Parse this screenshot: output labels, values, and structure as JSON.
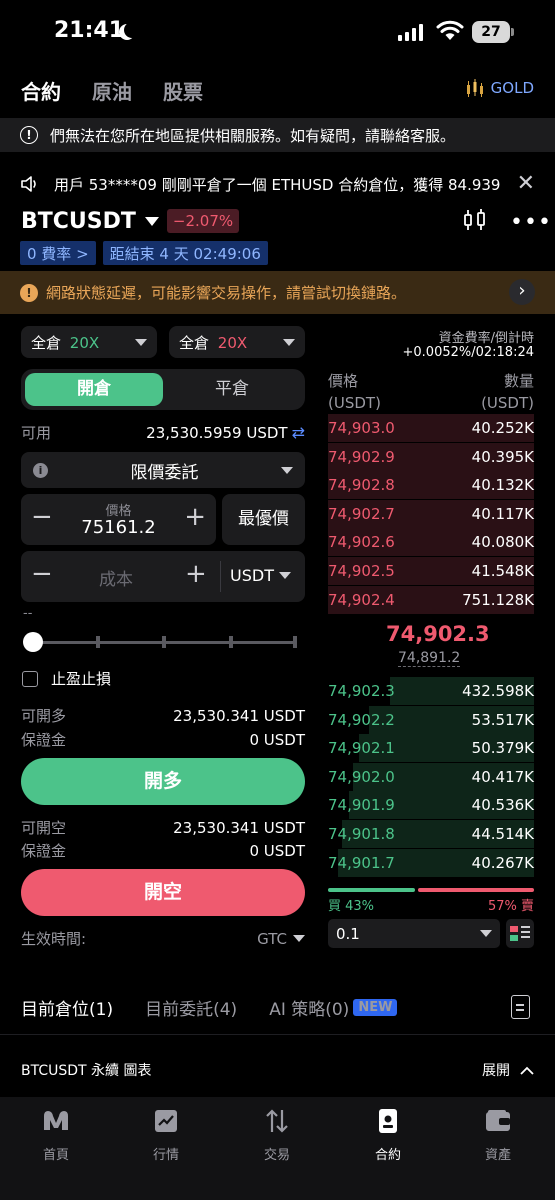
{
  "status_bar": {
    "time": "21:41",
    "battery": "27"
  },
  "top_tabs": [
    "合約",
    "原油",
    "股票"
  ],
  "gold_label": "GOLD",
  "notice": "們無法在您所在地區提供相關服務。如有疑問，請聯絡客服。",
  "ticker": "用戶 53****09 剛剛平倉了一個 ETHUSD 合約倉位，獲得 84.939",
  "symbol": {
    "name": "BTCUSDT",
    "change": "−2.07%"
  },
  "funding": {
    "rate_label": "0 費率 >",
    "countdown": "距結束 4 天 02:49:06"
  },
  "warning": "網路狀態延遲，可能影響交易操作，請嘗試切換鏈路。",
  "leverage": [
    {
      "mode": "全倉",
      "value": "20X",
      "color": "#4cc38a"
    },
    {
      "mode": "全倉",
      "value": "20X",
      "color": "#ef5a6f"
    }
  ],
  "segment": {
    "open": "開倉",
    "close": "平倉"
  },
  "available": {
    "label": "可用",
    "value": "23,530.5959 USDT"
  },
  "order_type": "限價委託",
  "price": {
    "label": "價格",
    "value": "75161.2",
    "best": "最優價"
  },
  "cost": {
    "placeholder": "成本",
    "unit": "USDT"
  },
  "slider": {
    "dash": "--",
    "value_percent": 0
  },
  "tpsl": "止盈止損",
  "long": {
    "can_open_label": "可開多",
    "can_open_value": "23,530.341 USDT",
    "margin_label": "保證金",
    "margin_value": "0 USDT",
    "button": "開多"
  },
  "short": {
    "can_open_label": "可開空",
    "can_open_value": "23,530.341 USDT",
    "margin_label": "保證金",
    "margin_value": "0 USDT",
    "button": "開空"
  },
  "effective": {
    "label": "生效時間:",
    "value": "GTC"
  },
  "orderbook": {
    "fund_label": "資金費率/倒計時",
    "fund_value": "+0.0052%/02:18:24",
    "price_header": [
      "價格",
      "(USDT)"
    ],
    "qty_header": [
      "數量",
      "(USDT)"
    ],
    "asks": [
      {
        "price": "74,903.0",
        "qty": "40.252K",
        "depth": 1.0
      },
      {
        "price": "74,902.9",
        "qty": "40.395K",
        "depth": 1.0
      },
      {
        "price": "74,902.8",
        "qty": "40.132K",
        "depth": 1.0
      },
      {
        "price": "74,902.7",
        "qty": "40.117K",
        "depth": 1.0
      },
      {
        "price": "74,902.6",
        "qty": "40.080K",
        "depth": 1.0
      },
      {
        "price": "74,902.5",
        "qty": "41.548K",
        "depth": 1.0
      },
      {
        "price": "74,902.4",
        "qty": "751.128K",
        "depth": 1.0
      }
    ],
    "mid": "74,902.3",
    "mark": "74,891.2",
    "bids": [
      {
        "price": "74,902.3",
        "qty": "432.598K",
        "depth": 0.7
      },
      {
        "price": "74,902.2",
        "qty": "53.517K",
        "depth": 0.8
      },
      {
        "price": "74,902.1",
        "qty": "50.379K",
        "depth": 0.85
      },
      {
        "price": "74,902.0",
        "qty": "40.417K",
        "depth": 0.88
      },
      {
        "price": "74,901.9",
        "qty": "40.536K",
        "depth": 0.9
      },
      {
        "price": "74,901.8",
        "qty": "44.514K",
        "depth": 0.93
      },
      {
        "price": "74,901.7",
        "qty": "40.267K",
        "depth": 0.95
      }
    ],
    "buy_label": "買 43%",
    "sell_label": "57% 賣",
    "buy_ratio": 43,
    "depth": "0.1"
  },
  "position_tabs": {
    "positions": "目前倉位(1)",
    "orders": "目前委託(4)",
    "ai": "AI 策略(0)",
    "new_badge": "NEW"
  },
  "chart_row": {
    "title": "BTCUSDT 永續 圖表",
    "expand": "展開"
  },
  "tabbar": [
    "首頁",
    "行情",
    "交易",
    "合約",
    "資產"
  ],
  "colors": {
    "green": "#4cc38a",
    "red": "#ef5a6f",
    "blue": "#5b8cff"
  }
}
